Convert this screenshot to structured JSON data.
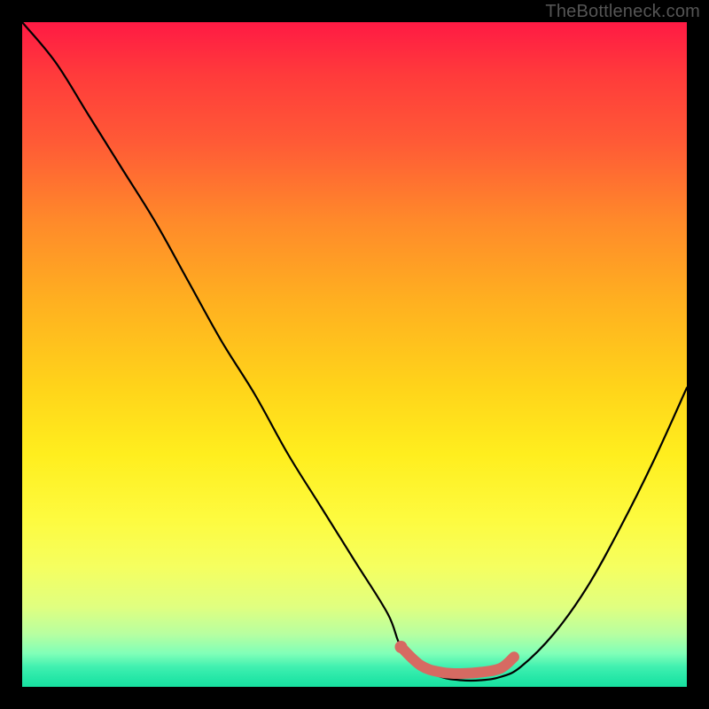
{
  "watermark": "TheBottleneck.com",
  "chart_data": {
    "type": "line",
    "title": "",
    "xlabel": "",
    "ylabel": "",
    "xlim": [
      0,
      100
    ],
    "ylim": [
      0,
      100
    ],
    "series": [
      {
        "name": "bottleneck-curve",
        "x": [
          0,
          5,
          10,
          15,
          20,
          25,
          30,
          35,
          40,
          45,
          50,
          55,
          57,
          60,
          63,
          66,
          69,
          72,
          75,
          80,
          85,
          90,
          95,
          100
        ],
        "values": [
          100,
          94,
          86,
          78,
          70,
          61,
          52,
          44,
          35,
          27,
          19,
          11,
          6,
          3,
          1.5,
          1,
          1,
          1.5,
          3,
          8,
          15,
          24,
          34,
          45
        ]
      }
    ],
    "highlight": {
      "name": "optimal-range",
      "color": "#d66a62",
      "x": [
        57,
        60,
        63,
        66,
        69,
        72,
        74
      ],
      "values": [
        6,
        3.2,
        2.2,
        2,
        2.2,
        2.8,
        4.5
      ]
    }
  }
}
